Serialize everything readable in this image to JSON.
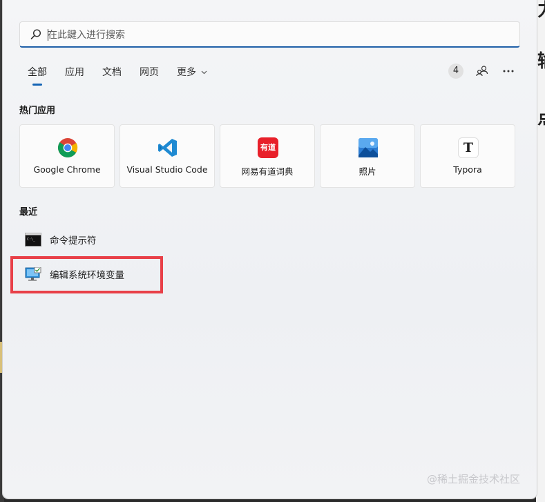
{
  "search": {
    "placeholder": "在此鍵入进行搜索"
  },
  "tabs": [
    {
      "label": "全部"
    },
    {
      "label": "应用"
    },
    {
      "label": "文档"
    },
    {
      "label": "网页"
    },
    {
      "label": "更多"
    }
  ],
  "header": {
    "badge_count": "4"
  },
  "top_apps": {
    "title": "热门应用",
    "items": [
      {
        "label": "Google Chrome",
        "icon": "chrome-icon"
      },
      {
        "label": "Visual Studio Code",
        "icon": "vscode-icon"
      },
      {
        "label": "网易有道词典",
        "icon": "youdao-icon",
        "icon_text": "有道"
      },
      {
        "label": "照片",
        "icon": "photos-icon"
      },
      {
        "label": "Typora",
        "icon": "typora-icon",
        "icon_text": "T"
      }
    ]
  },
  "recent": {
    "title": "最近",
    "items": [
      {
        "label": "命令提示符",
        "icon": "cmd-icon"
      },
      {
        "label": "编辑系统环境变量",
        "icon": "system-properties-icon"
      }
    ]
  },
  "watermark": "@稀土掘金技术社区",
  "colors": {
    "accent": "#1464b4",
    "highlight": "#e84048"
  }
}
